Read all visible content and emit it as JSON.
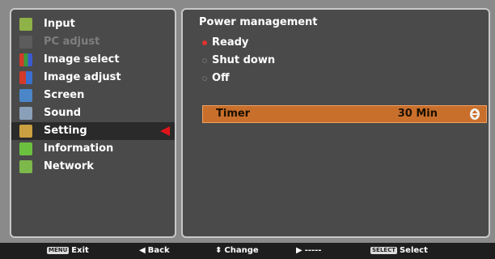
{
  "menu": {
    "items": [
      {
        "label": "Input",
        "icon": "input-icon",
        "icon_color": "#8fb248",
        "state": "normal"
      },
      {
        "label": "PC adjust",
        "icon": "pc-adjust-icon",
        "icon_color": "#5c5c5c",
        "state": "disabled"
      },
      {
        "label": "Image select",
        "icon": "image-select-icon",
        "icon_color": "#d23a2a",
        "state": "normal"
      },
      {
        "label": "Image adjust",
        "icon": "image-adjust-icon",
        "icon_color": "#3a6fd0",
        "state": "normal"
      },
      {
        "label": "Screen",
        "icon": "screen-icon",
        "icon_color": "#4a86c8",
        "state": "normal"
      },
      {
        "label": "Sound",
        "icon": "sound-icon",
        "icon_color": "#8aa0b8",
        "state": "normal"
      },
      {
        "label": "Setting",
        "icon": "setting-icon",
        "icon_color": "#caa040",
        "state": "selected"
      },
      {
        "label": "Information",
        "icon": "information-icon",
        "icon_color": "#6cc040",
        "state": "normal"
      },
      {
        "label": "Network",
        "icon": "network-icon",
        "icon_color": "#7cb84a",
        "state": "normal"
      }
    ]
  },
  "power": {
    "title": "Power management",
    "options": [
      {
        "label": "Ready",
        "selected": true
      },
      {
        "label": "Shut down",
        "selected": false
      },
      {
        "label": "Off",
        "selected": false
      }
    ],
    "timer_label": "Timer",
    "timer_value": "30 Min"
  },
  "help": {
    "exit_key": "MENU",
    "exit_label": "Exit",
    "back_label": "Back",
    "change_label": "Change",
    "next_label": "-----",
    "select_key": "SELECT",
    "select_label": "Select"
  },
  "colors": {
    "panel": "#4a4a4a",
    "highlight": "#c96f2c",
    "selection_arrow": "#e0151a"
  }
}
